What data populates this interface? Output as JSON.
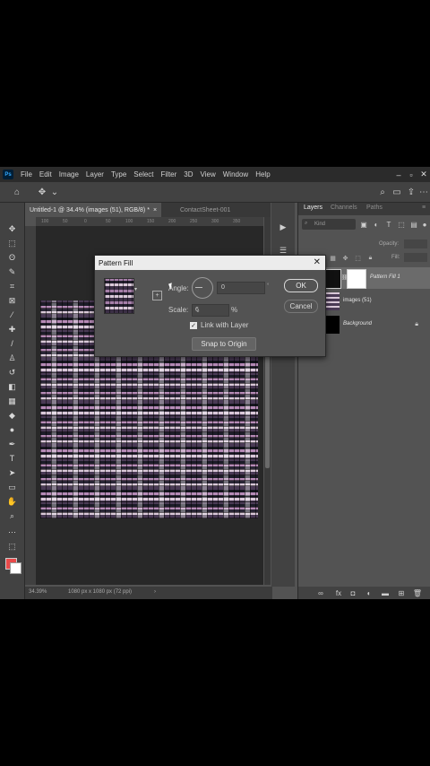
{
  "menu": {
    "logo": "Ps",
    "items": [
      "File",
      "Edit",
      "Image",
      "Layer",
      "Type",
      "Select",
      "Filter",
      "3D",
      "View",
      "Window",
      "Help"
    ]
  },
  "tabs": {
    "active": "Untitled-1 @ 34.4% (images (51), RGB/8) *",
    "inactive": "ContactSheet-001"
  },
  "ruler": {
    "ticks": [
      "100",
      "50",
      "0",
      "50",
      "100",
      "150",
      "200",
      "250",
      "300",
      "350"
    ]
  },
  "status": {
    "zoom": "34.39%",
    "doc_size": "1080 px x 1080 px (72 ppi)"
  },
  "layers_panel": {
    "tabs": [
      "Layers",
      "Channels",
      "Paths"
    ],
    "filter_placeholder": "Kind",
    "opacity_label": "Opacity:",
    "fill_label": "Fill:",
    "layers": [
      {
        "name": "Pattern Fill 1",
        "selected": true
      },
      {
        "name": "images (51)",
        "selected": false
      },
      {
        "name": "Background",
        "selected": false,
        "locked": true
      }
    ]
  },
  "dialog": {
    "title": "Pattern Fill",
    "angle_label": "Angle:",
    "angle_value": "0",
    "angle_unit": "°",
    "scale_label": "Scale:",
    "scale_value": "6",
    "scale_unit": "%",
    "link_with_layer_label": "Link with Layer",
    "link_with_layer_checked": true,
    "snap_button": "Snap to Origin",
    "ok_button": "OK",
    "cancel_button": "Cancel"
  },
  "colors": {
    "app_bg": "#535353",
    "menubar_bg": "#2b2b2b",
    "foreground_color": "#e94a4a",
    "background_color": "#ffffff",
    "dialog_titlebar": "#ececec"
  }
}
